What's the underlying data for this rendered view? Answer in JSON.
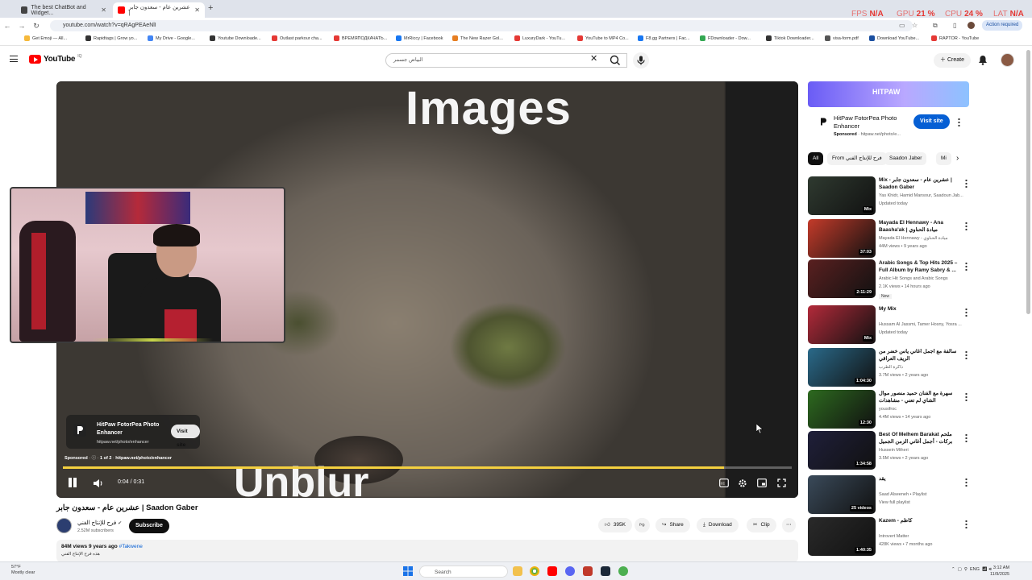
{
  "browser": {
    "tabs": [
      {
        "title": "The best ChatBot and Widget..."
      },
      {
        "title": "عشرين عام - سعدون جابر |"
      }
    ],
    "url": "youtube.com/watch?v=qRAgPEAeNlI",
    "action_required": "Action required",
    "perf": {
      "fps_label": "FPS",
      "fps": "N/A",
      "gpu_label": "GPU",
      "gpu": "21 %",
      "cpu_label": "CPU",
      "cpu": "24 %",
      "lat_label": "LAT",
      "lat": "N/A"
    },
    "bookmarks": [
      "Get Emoji — All...",
      "Rapidtags | Grow yo...",
      "My Drive - Google...",
      "Youtube Downloade...",
      "Outlast parkour cha...",
      "ВРЕМЯПОДКАЧАТЬ...",
      "MrRiccy | Facebook",
      "The New Razer Gol...",
      "LuxuryDark - YouTu...",
      "YouTube to MP4 Co...",
      "F8.gg Partners | Fac...",
      "FDownloader - Dow...",
      "Tiktok Downloader...",
      "visa-form.pdf",
      "Download YouTube...",
      "RAPTOR - YouTube"
    ]
  },
  "youtube": {
    "logo": "YouTube",
    "logo_country": "IQ",
    "search_value": "البياض جسمر",
    "create_label": "Create"
  },
  "player": {
    "overlay_title": "Images",
    "overlay_bottom": "Unblur",
    "ad": {
      "title": "HitPaw FotorPea Photo Enhancer",
      "url": "hitpaw.net/photo/enhancer",
      "visit": "Visit site"
    },
    "sponsored": "Sponsored",
    "sponsored_count": "1 of 2",
    "sponsored_url": "hitpaw.net/photo/enhancer",
    "time": "0:04 / 0:31",
    "progress": 0.907
  },
  "side_ad": {
    "banner": "HITPAW",
    "title": "HitPaw FotorPea Photo Enhancer",
    "sponsored": "Sponsored",
    "url": "hitpaw.net/photo/e...",
    "visit": "Visit site"
  },
  "chips": [
    "All",
    "From فرح للإنتاج الفني",
    "Saadon Jaber",
    "Mi"
  ],
  "recommendations": [
    {
      "title": "Mix - عشرين عام - سعدون جابر | Saadon Gaber",
      "meta1": "Yas Khidr, Hamid Mansour, Saadoun Jab...",
      "meta2": "Updated today",
      "duration": "Mix",
      "badge": "",
      "color": "#2f3a30"
    },
    {
      "title": "Mayada El Hennawy - Ana Baasha'ak | ميادة الحناوي",
      "meta1": "Mayada El Hennawy - ميادة الحناوي",
      "meta2": "44M views • 9 years ago",
      "duration": "37:03",
      "badge": "",
      "color": "#c43b2a"
    },
    {
      "title": "Arabic Songs & Top Hits 2025 – Full Album by Ramy Sabry & ...",
      "meta1": "Arabic Hit Songs and Arabic Songs",
      "meta2": "2.1K views • 14 hours ago",
      "duration": "2:11:29",
      "badge": "New",
      "color": "#5a2020"
    },
    {
      "title": "My Mix",
      "meta1": "Hussam Al Jassmi, Tamer Hosny, Yosra ...",
      "meta2": "Updated today",
      "duration": "Mix",
      "badge": "",
      "color": "#b32a3a"
    },
    {
      "title": "سالفة مع أجمل أغاني ياس خضر من الريف العراقي",
      "meta1": "ذاكرة الطرب",
      "meta2": "3.7M views • 2 years ago",
      "duration": "1:04:30",
      "badge": "",
      "color": "#2a6a8a"
    },
    {
      "title": "سهرة مع الفنان حميد منصور موال الشاي لم تعني - مشاهدات",
      "meta1": "yousifroc",
      "meta2": "4.4M views • 14 years ago",
      "duration": "12:30",
      "badge": "",
      "color": "#2d6a1f"
    },
    {
      "title": "Best Of Melhem Barakat ملحم بركات - أجمل أغاني الزمن الجميل",
      "meta1": "Hussein Mtheri",
      "meta2": "3.5M views • 2 years ago",
      "duration": "1:34:58",
      "badge": "",
      "color": "#1f1f3a"
    },
    {
      "title": "يقد",
      "meta1": "Saad Alseeneh • Playlist",
      "meta2": "View full playlist",
      "duration": "25 videos",
      "badge": "",
      "color": "#3a4a5a"
    },
    {
      "title": "Kazem - كاظم",
      "meta1": "Introvert Matter",
      "meta2": "428K views • 7 months ago",
      "duration": "1:40:35",
      "badge": "",
      "color": "#2a2a2a"
    }
  ],
  "video": {
    "title": "عشرين عام - سعدون جابر | Saadon Gaber",
    "channel": "فرح للإنتاج الفني",
    "subscribers": "2.52M subscribers",
    "subscribe": "Subscribe",
    "likes": "395K",
    "share": "Share",
    "download": "Download",
    "clip": "Clip",
    "views": "84M views",
    "age": "9 years ago",
    "tag": "#Takwene",
    "desc": "هذه فرح الإنتاج الفني"
  },
  "taskbar": {
    "temp": "57°F",
    "weather": "Mostly clear",
    "search": "Search",
    "lang": "ENG",
    "time": "3:12 AM",
    "date": "11/9/2025"
  },
  "colors": {
    "accent": "#065fd4",
    "yt_red": "#ff0000",
    "progress": "#f4d03f",
    "perf": "#e53935"
  }
}
